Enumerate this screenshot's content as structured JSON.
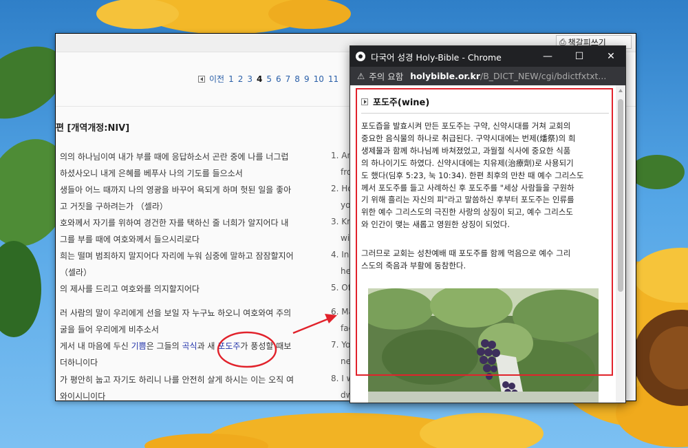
{
  "main": {
    "corner_button": "책갈피쓰기",
    "pager": {
      "prev": "이전",
      "pages": [
        "1",
        "2",
        "3",
        "4",
        "5",
        "6",
        "7",
        "8",
        "9",
        "10",
        "11"
      ],
      "current": "4"
    },
    "heading": "편 [개역개정:NIV]",
    "korean_lines": [
      "의의 하나님이여 내가 부를 때에 응답하소서 곤란 중에 나를 너그럽",
      "하셨사오니 내게 은혜를 베푸사 나의 기도를 들으소서",
      "생들아 어느 때까지 나의 영광을 바꾸어 욕되게 하며 헛된 일을 좋아",
      "고 거짓을 구하려는가 （셀라）",
      "호와께서 자기를 위하여 경건한 자를 택하신 줄 너희가 알지어다 내",
      "그를 부를 때에 여호와께서 들으시리로다",
      "희는 떨며 범죄하지 말지어다 자리에 누워 심중에 말하고 잠잠할지어",
      "（셀라）",
      "의 제사를 드리고 여호와를 의지할지어다",
      "러 사람의 말이 우리에게 선을 보일 자 누구뇨 하오니 여호와여 주의",
      "굴을 들어 우리에게 비추소서",
      "게서 내 마음에 두신 기쁨은 그들의 곡식과 새 포도주가 풍성할 때보",
      "더하니이다",
      "가 평안히 눕고 자기도 하리니 나를 안전히 살게 하시는 이는 오직 여",
      "와이시니이다"
    ],
    "verse8_parts": {
      "pre": "게서 내 마음에 두신 ",
      "joy": "기쁨",
      "mid": "은 그들의 ",
      "grain": "곡식",
      "and": "과 새 ",
      "wine": "포도주",
      "post": "가 풍성할 때보"
    },
    "english_lines": [
      "1. Ans",
      "fro",
      "2. Ho",
      "you",
      "3. Kno",
      "will",
      "4. In y",
      "hea",
      "5. Off",
      "6. Ma",
      "fac",
      "7. You",
      "nev",
      "8. I wi",
      "dw"
    ]
  },
  "popup": {
    "title": "다국어 성경 Holy-Bible - Chrome",
    "security": "주의 요함",
    "url_host": "holybible.or.kr",
    "url_path": "/B_DICT_NEW/cgi/bdictfxtxt...",
    "word": "포도주(wine)",
    "para1": [
      "포도즙을 발효시켜 만든 포도주는 구약, 신약시대를 거쳐 교회의",
      "중요한 음식물의 하나로 취급된다. 구약시대에는 번제(燔祭)의 희",
      "생제물과 함께 하나님께 바쳐졌었고, 과월절 식사에 중요한 식품",
      "의 하나이기도 하였다. 신약시대에는 치유제(治療劑)로 사용되기",
      "도 했다(딤후 5:23, 눅 10:34). 한편 최후의 만찬 때 예수 그리스도",
      "께서 포도주를 들고 사례하신 후 포도주를 \"세상 사람들을 구원하",
      "기 위해 흘리는 자신의 피\"라고 말씀하신 후부터 포도주는 인류를",
      "위한 예수 그리스도의 극진한 사랑의 상징이 되고, 예수 그리스도",
      "와 인간이 맺는 새롭고 영원한 상징이 되었다."
    ],
    "para2": [
      "그러므로 교회는 성찬예배 때 포도주를 함께 먹음으로 예수 그리",
      "스도의 죽음과 부활에 동참한다."
    ]
  },
  "colors": {
    "annotation_red": "#e1222b",
    "link_blue": "#2a5fa8",
    "title_bar": "#202124",
    "address_bar": "#35363a",
    "sky": "#4a9be0",
    "sunflower": "#f0b51f"
  }
}
